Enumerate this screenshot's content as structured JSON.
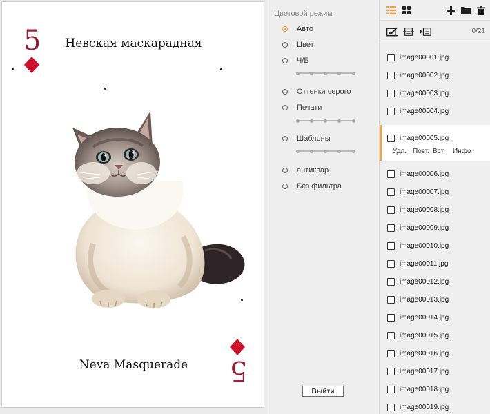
{
  "card": {
    "rank": "5",
    "suit_icon": "diamond-icon",
    "title_ru": "Невская маскарадная",
    "title_en": "Neva Masquerade",
    "suit_color": "#d0112b",
    "rank_color": "#9a1e34"
  },
  "color_mode": {
    "title": "Цветовой режим",
    "options": [
      "Авто",
      "Цвет",
      "Ч/Б",
      "Оттенки серого",
      "Печати",
      "Шаблоны",
      "антиквар",
      "Без фильтра"
    ],
    "selected": "Авто",
    "exit_label": "Выйти",
    "accent": "#f0a040"
  },
  "files": {
    "counter": "0/21",
    "toolbar_icons": [
      "list-view-icon",
      "grid-view-icon",
      "add-icon",
      "folder-icon",
      "trash-icon"
    ],
    "secondary_icons": [
      "select-all-icon",
      "move-icon",
      "rotate-page-icon"
    ],
    "items": [
      "image00001.jpg",
      "image00002.jpg",
      "image00003.jpg",
      "image00004.jpg",
      "image00005.jpg",
      "image00006.jpg",
      "image00007.jpg",
      "image00008.jpg",
      "image00009.jpg",
      "image00010.jpg",
      "image00011.jpg",
      "image00012.jpg",
      "image00013.jpg",
      "image00014.jpg",
      "image00015.jpg",
      "image00016.jpg",
      "image00017.jpg",
      "image00018.jpg",
      "image00019.jpg"
    ],
    "selected_item_actions": {
      "delete": "Удл.",
      "repeat": "Повт.",
      "insert": "Вст.",
      "info": "Инфо"
    }
  }
}
